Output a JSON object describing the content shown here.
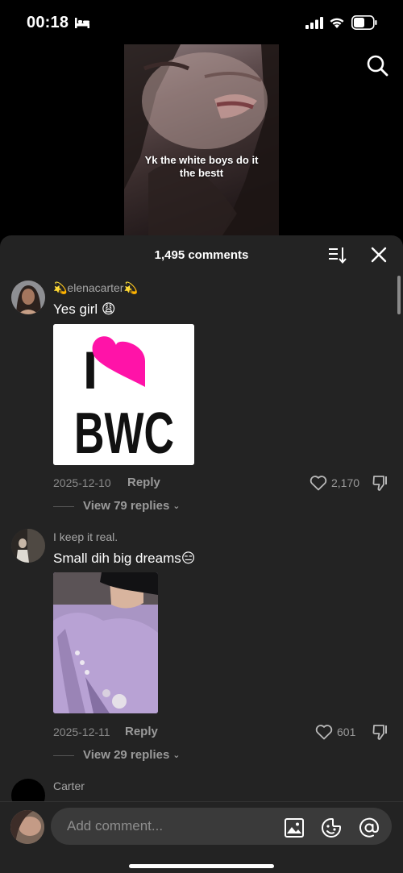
{
  "status": {
    "time": "00:18"
  },
  "video": {
    "caption_line1": "Yk the white boys do it",
    "caption_line2": "the bestt"
  },
  "sheet": {
    "comment_count": "1,495 comments"
  },
  "comments": [
    {
      "username": "💫elenacarter💫",
      "text": "Yes girl 😩",
      "sticker_top": "I",
      "sticker_bottom": "BWC",
      "date": "2025-12-10",
      "reply_label": "Reply",
      "likes": "2,170",
      "view_replies": "View 79 replies"
    },
    {
      "username": "I keep it real.",
      "text": "Small dih big dreams😑",
      "date": "2025-12-11",
      "reply_label": "Reply",
      "likes": "601",
      "view_replies": "View 29 replies"
    },
    {
      "username": "Carter"
    }
  ],
  "composer": {
    "placeholder": "Add comment..."
  },
  "colors": {
    "sheet_bg": "#232323",
    "heart_pink": "#ff13a8",
    "text_secondary": "#9a9a9a"
  }
}
